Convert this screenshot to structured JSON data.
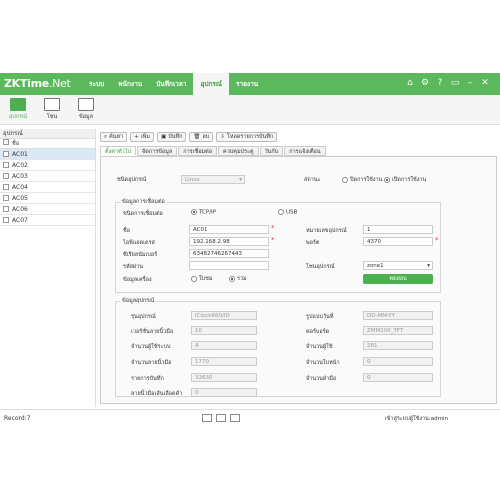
{
  "app": {
    "logo_main": "ZKTime",
    "logo_sub": ".Net"
  },
  "menu": [
    "ระบบ",
    "พนักงาน",
    "บันทึกเวลา",
    "อุปกรณ์",
    "รายงาน"
  ],
  "subbar": [
    "อุปกรณ์",
    "โซน",
    "ข้อมูล"
  ],
  "left": {
    "header": "อุปกรณ์",
    "col": "ชื่อ",
    "rows": [
      "AC01",
      "AC02",
      "AC03",
      "AC04",
      "AC05",
      "AC06",
      "AC07"
    ]
  },
  "toolbar": [
    "ค้นหา",
    "เพิ่ม",
    "บันทึก",
    "ลบ",
    "โหลดรายการบันทึก"
  ],
  "tabs": [
    "ตั้งค่าทั่วไป",
    "จัดการข้อมูล",
    "การเชื่อมต่อ",
    "ควบคุมประตู",
    "วันกับ",
    "การแจ้งเตือน"
  ],
  "form": {
    "device_type_label": "ชนิดอุปกรณ์",
    "device_type_value": "Linux",
    "status_label": "สถานะ",
    "status_off": "ปิดการใช้งาน",
    "status_on": "เปิดการใช้งาน",
    "conn_group": "ข้อมูลการเชื่อมต่อ",
    "conn_type_label": "ชนิดการเชื่อมต่อ",
    "tcp": "TCP/IP",
    "usb": "USB",
    "name_label": "ชื่อ",
    "name_value": "AC01",
    "device_no_label": "หมายเลขอุปกรณ์",
    "device_no_value": "1",
    "ip_label": "ไอพีแอดเดรส",
    "ip_value": "192.168.2.98",
    "port_label": "พอร์ต",
    "port_value": "4370",
    "serial_label": "ซีเรียลนัมเบอร์",
    "serial_value": "63482746267443",
    "pass_label": "รหัสผ่าน",
    "pass_value": "",
    "zone_label": "โซนอุปกรณ์",
    "zone_value": "zone1",
    "machine_label": "ข้อมูลเครื่อง",
    "m_opt1": "ใบชม",
    "m_opt2": "รวม",
    "save": "ทดสอบ",
    "info_group": "ข้อมูลอุปกรณ์",
    "model_label": "รุ่นอุปกรณ์",
    "model_value": "iClock660/ID",
    "datefmt_label": "รูปแบบวันที่",
    "datefmt_value": "DD-MM-YY",
    "fpver_label": "เวอร์ชั่นลายนิ้วมือ",
    "fpver_value": "10",
    "algo_label": "คอร์บอร์ด",
    "algo_value": "ZMM100_TFT",
    "users_label": "จำนวนผู้ใช้ระบบ",
    "users_value": "4",
    "usercount_label": "จำนวนผู้ใช้",
    "usercount_value": "281",
    "fpcount_label": "จำนวนลายนิ้วมือ",
    "fpcount_value": "1770",
    "face_label": "จำนวนใบหน้า",
    "face_value": "0",
    "records_label": "รายการบันทึก",
    "records_value": "32630",
    "palm_label": "จำนวนฝ่ามือ",
    "palm_value": "0",
    "vein_label": "ลายนิ้วมือเส้นเลือดดำ",
    "vein_value": "0"
  },
  "status": {
    "record": "Record:7",
    "right": "เข้าสู่ระบบผู้ใช้งาน:admin"
  }
}
